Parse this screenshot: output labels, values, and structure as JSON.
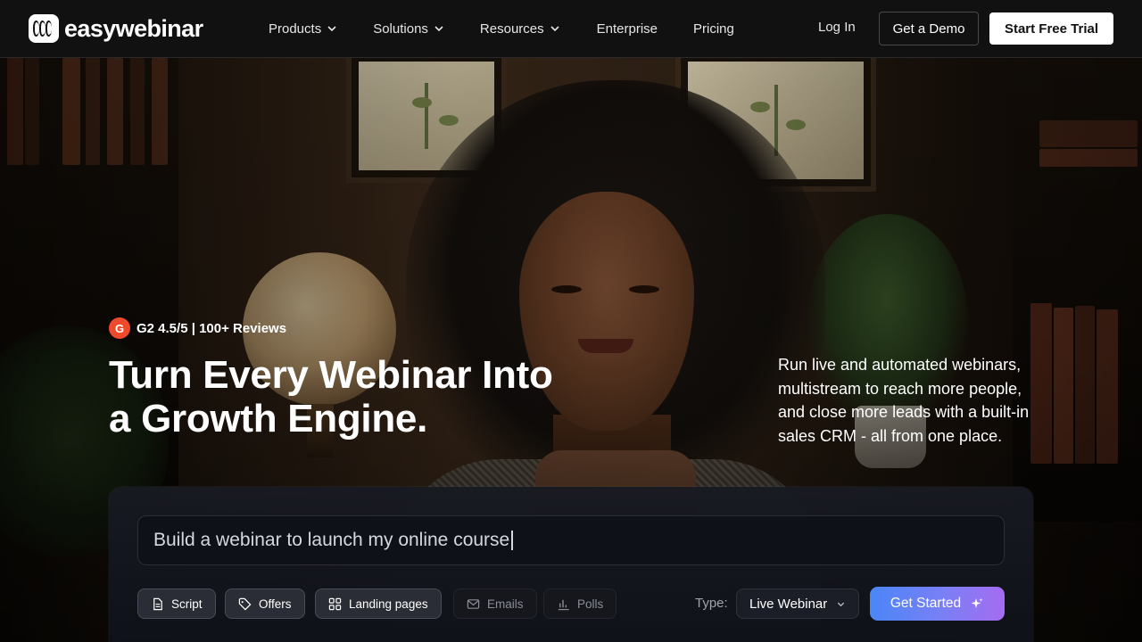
{
  "brand": {
    "name": "easywebinar"
  },
  "nav": {
    "items": [
      {
        "label": "Products",
        "dropdown": true
      },
      {
        "label": "Solutions",
        "dropdown": true
      },
      {
        "label": "Resources",
        "dropdown": true
      },
      {
        "label": "Enterprise",
        "dropdown": false
      },
      {
        "label": "Pricing",
        "dropdown": false
      }
    ],
    "login": "Log In",
    "demo": "Get a Demo",
    "trial": "Start Free Trial"
  },
  "hero": {
    "rating_badge": "G",
    "rating": "G2 4.5/5 | 100+ Reviews",
    "headline_line1": "Turn Every Webinar Into",
    "headline_line2": "a Growth Engine.",
    "subcopy": "Run live and automated webinars, multistream to reach more people, and close more leads with a built-in sales CRM - all from one place."
  },
  "builder": {
    "prompt_value": "Build a webinar to launch my online course",
    "chips": [
      {
        "label": "Script",
        "icon": "document-icon",
        "active": true
      },
      {
        "label": "Offers",
        "icon": "tag-icon",
        "active": true
      },
      {
        "label": "Landing pages",
        "icon": "grid-icon",
        "active": true
      },
      {
        "label": "Emails",
        "icon": "mail-icon",
        "active": false
      },
      {
        "label": "Polls",
        "icon": "bar-chart-icon",
        "active": false
      }
    ],
    "type_label": "Type:",
    "type_value": "Live Webinar",
    "cta": "Get Started",
    "cta_icon": "sparkle-icon"
  },
  "colors": {
    "nav_bg": "#111112",
    "cta_gradient_start": "#4b86f7",
    "cta_gradient_end": "#a56cf0",
    "g2_red": "#ef4a2b"
  }
}
